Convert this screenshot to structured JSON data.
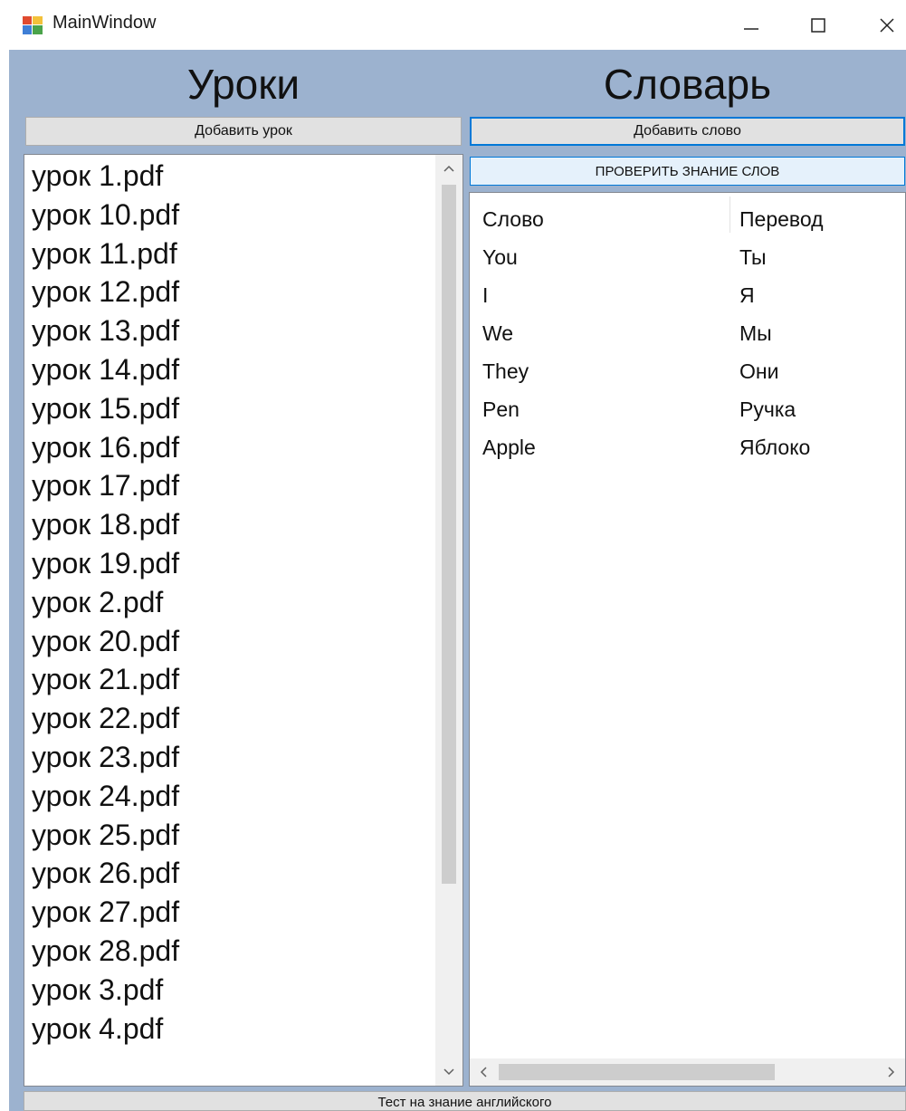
{
  "window": {
    "title": "MainWindow"
  },
  "lessons": {
    "heading": "Уроки",
    "add_button": "Добавить урок",
    "items": [
      "урок 1.pdf",
      "урок 10.pdf",
      "урок 11.pdf",
      "урок 12.pdf",
      "урок 13.pdf",
      "урок 14.pdf",
      "урок 15.pdf",
      "урок 16.pdf",
      "урок 17.pdf",
      "урок 18.pdf",
      "урок 19.pdf",
      "урок 2.pdf",
      "урок 20.pdf",
      "урок 21.pdf",
      "урок 22.pdf",
      "урок 23.pdf",
      "урок 24.pdf",
      "урок 25.pdf",
      "урок 26.pdf",
      "урок 27.pdf",
      "урок 28.pdf",
      "урок 3.pdf",
      "урок 4.pdf"
    ]
  },
  "dictionary": {
    "heading": "Словарь",
    "add_button": "Добавить слово",
    "check_button": "ПРОВЕРИТЬ ЗНАНИЕ СЛОВ",
    "columns": [
      "Слово",
      "Перевод"
    ],
    "rows": [
      [
        "You",
        "Ты"
      ],
      [
        "I",
        "Я"
      ],
      [
        "We",
        "Мы"
      ],
      [
        "They",
        "Они"
      ],
      [
        "Pen",
        "Ручка"
      ],
      [
        "Apple",
        "Яблоко"
      ]
    ]
  },
  "footer": {
    "test_button": "Тест на знание английского"
  },
  "icons": {
    "app": "app-window-icon",
    "minimize": "minimize-icon",
    "maximize": "maximize-icon",
    "close": "close-icon",
    "scroll_up": "chevron-up-icon",
    "scroll_down": "chevron-down-icon",
    "scroll_left": "chevron-left-icon",
    "scroll_right": "chevron-right-icon"
  },
  "colors": {
    "client_bg": "#9cb2cf",
    "focus_border": "#0078d7",
    "button_bg": "#e1e1e1"
  }
}
